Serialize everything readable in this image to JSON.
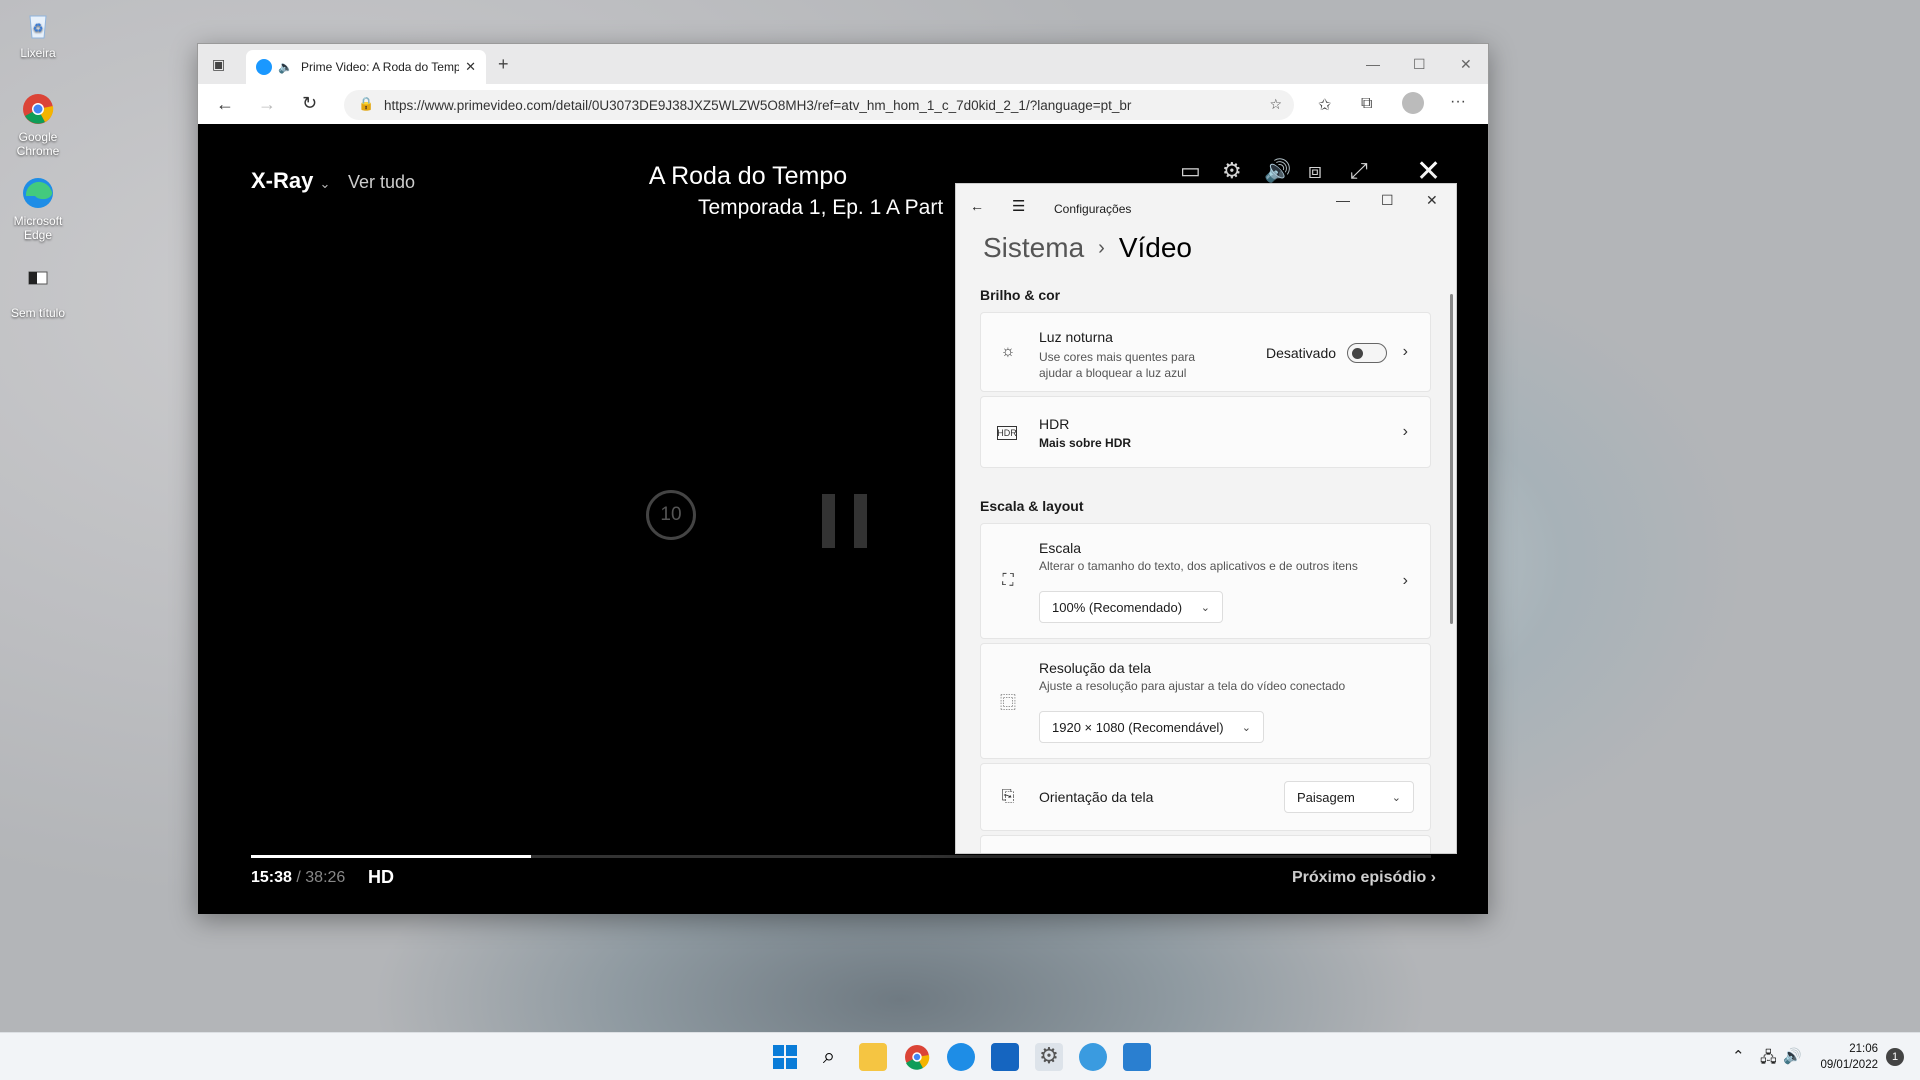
{
  "desktop": {
    "icons": [
      {
        "label": "Lixeira"
      },
      {
        "label": "Google Chrome"
      },
      {
        "label": "Microsoft Edge"
      },
      {
        "label": "Sem título"
      }
    ]
  },
  "browser": {
    "tab_title": "Prime Video: A Roda do Tempo",
    "url": "https://www.primevideo.com/detail/0U3073DE9J38JXZ5WLZW5O8MH3/ref=atv_hm_hom_1_c_7d0kid_2_1/?language=pt_br"
  },
  "player": {
    "xray_label": "X-Ray",
    "ver_tudo": "Ver tudo",
    "title": "A Roda do Tempo",
    "subtitle": "Temporada 1, Ep. 1 A Part",
    "replay_seconds": "10",
    "current_time": "15:38",
    "separator": "/",
    "total_time": "38:26",
    "quality": "HD",
    "next_episode": "Próximo episódio ›",
    "progress_fraction": 0.237
  },
  "settings": {
    "app_title": "Configurações",
    "breadcrumb_parent": "Sistema",
    "breadcrumb_current": "Vídeo",
    "section_brightness": "Brilho & cor",
    "night_light": {
      "title": "Luz noturna",
      "desc_line1": "Use cores mais quentes para",
      "desc_line2": "ajudar a bloquear a luz azul",
      "state": "Desativado"
    },
    "hdr": {
      "title": "HDR",
      "link": "Mais sobre HDR"
    },
    "section_scale": "Escala & layout",
    "scale": {
      "title": "Escala",
      "desc": "Alterar o tamanho do texto, dos aplicativos e de outros itens",
      "value": "100% (Recomendado)"
    },
    "resolution": {
      "title": "Resolução da tela",
      "desc": "Ajuste a resolução para ajustar a tela do  vídeo conectado",
      "value": "1920 × 1080 (Recomendável)"
    },
    "orientation": {
      "title": "Orientação da tela",
      "value": "Paisagem"
    }
  },
  "taskbar": {
    "time": "21:06",
    "date": "09/01/2022",
    "notifications": "1"
  }
}
